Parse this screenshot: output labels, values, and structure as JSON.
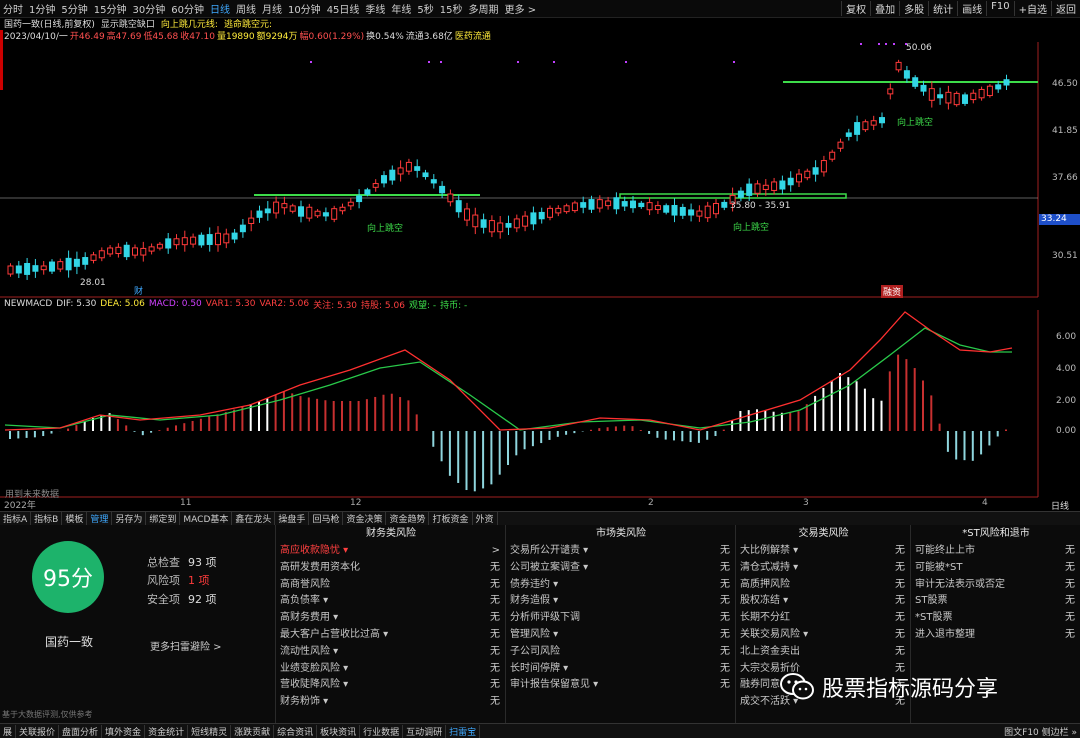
{
  "topbar": {
    "periods": [
      "分时",
      "1分钟",
      "5分钟",
      "15分钟",
      "30分钟",
      "60分钟",
      "日线",
      "周线",
      "月线",
      "10分钟",
      "45日线",
      "季线",
      "年线",
      "5秒",
      "15秒",
      "多周期",
      "更多 >"
    ],
    "active_index": 6,
    "right_buttons": [
      "复权",
      "叠加",
      "多股",
      "统计",
      "画线",
      "F10",
      "+自选",
      "返回"
    ]
  },
  "title_line": {
    "name": "国药一致(日线,前复权)",
    "toggle": "显示跳空缺口",
    "ind1": "向上跳几元线: ",
    "ind2": "逃命跳空元: "
  },
  "quote_line": {
    "date": "2023/04/10/一",
    "open": "开46.49",
    "high": "高47.69",
    "low": "低45.68",
    "close": "收47.10",
    "vol": "量19890",
    "amount": "额9294万",
    "change": "幅0.60(1.29%)",
    "turnover": "换0.54%",
    "float": "流通3.68亿",
    "sector": "医药流通"
  },
  "price_axis": [
    "46.50",
    "41.85",
    "37.66",
    "33.24",
    "30.51"
  ],
  "current_price": "33.24",
  "annotations": {
    "high": "50.06",
    "low": "28.01",
    "gap_range": "35.80 - 35.91",
    "gap_label": "向上跳空",
    "marker1": "财",
    "marker2": "融资"
  },
  "macd_legend": {
    "name": "NEWMACD",
    "dif": "DIF: 5.30",
    "dea": "DEA: 5.06",
    "macd": "MACD: 0.50",
    "var1": "VAR1: 5.30",
    "var2": "VAR2: 5.06",
    "attention": "关注: 5.30",
    "hold": "持股: 5.06",
    "watch": "观望: -",
    "holdcoin": "持币: -"
  },
  "macd_axis": [
    "6.00",
    "4.00",
    "2.00",
    "0.00"
  ],
  "future_label": "用到未来数据",
  "time_axis": [
    "2022年",
    "11",
    "12",
    "2",
    "3",
    "4"
  ],
  "day_button": "日线",
  "tabs": [
    "指标A",
    "指标B",
    "模板",
    "管理",
    "另存为",
    "绑定到",
    "MACD基本",
    "鑫在龙头",
    "操盘手",
    "回马枪",
    "资金决策",
    "资金趋势",
    "打板资金",
    "外资"
  ],
  "active_tab": 3,
  "score": {
    "value": "95分",
    "name": "国药一致",
    "total_label": "总检查",
    "total": "93 项",
    "risk_label": "风险项",
    "risk": "1 项",
    "safe_label": "安全项",
    "safe": "92 项",
    "more": "更多扫雷避险 >"
  },
  "risk_columns": [
    {
      "title": "财务类风险",
      "items": [
        {
          "name": "高应收款隐忧 ▾",
          "status": ">"
        },
        {
          "name": "高研发费用资本化",
          "status": "无"
        },
        {
          "name": "高商誉风险",
          "status": "无"
        },
        {
          "name": "高负债率 ▾",
          "status": "无"
        },
        {
          "name": "高财务费用 ▾",
          "status": "无"
        },
        {
          "name": "最大客户占营收比过高 ▾",
          "status": "无"
        },
        {
          "name": "流动性风险 ▾",
          "status": "无"
        },
        {
          "name": "业绩变脸风险 ▾",
          "status": "无"
        },
        {
          "name": "营收陡降风险 ▾",
          "status": "无"
        },
        {
          "name": "财务粉饰 ▾",
          "status": "无"
        }
      ]
    },
    {
      "title": "市场类风险",
      "items": [
        {
          "name": "交易所公开谴责 ▾",
          "status": "无"
        },
        {
          "name": "公司被立案调查 ▾",
          "status": "无"
        },
        {
          "name": "债券违约 ▾",
          "status": "无"
        },
        {
          "name": "财务造假 ▾",
          "status": "无"
        },
        {
          "name": "分析师评级下调",
          "status": "无"
        },
        {
          "name": "管理风险 ▾",
          "status": "无"
        },
        {
          "name": "子公司风险",
          "status": "无"
        },
        {
          "name": "长时间停牌 ▾",
          "status": "无"
        },
        {
          "name": "审计报告保留意见 ▾",
          "status": "无"
        }
      ]
    },
    {
      "title": "交易类风险",
      "items": [
        {
          "name": "大比例解禁 ▾",
          "status": "无"
        },
        {
          "name": "清仓式减持 ▾",
          "status": "无"
        },
        {
          "name": "高质押风险",
          "status": "无"
        },
        {
          "name": "股权冻结 ▾",
          "status": "无"
        },
        {
          "name": "长期不分红",
          "status": "无"
        },
        {
          "name": "关联交易风险 ▾",
          "status": "无"
        },
        {
          "name": "北上资金卖出",
          "status": "无"
        },
        {
          "name": "大宗交易折价",
          "status": "无"
        },
        {
          "name": "融券同意",
          "status": "无"
        },
        {
          "name": "成交不活跃 ▾",
          "status": "无"
        }
      ]
    },
    {
      "title": "*ST风险和退市",
      "items": [
        {
          "name": "可能终止上市",
          "status": "无"
        },
        {
          "name": "可能被*ST",
          "status": "无"
        },
        {
          "name": "审计无法表示或否定",
          "status": "无"
        },
        {
          "name": "ST股票",
          "status": "无"
        },
        {
          "name": "*ST股票",
          "status": "无"
        },
        {
          "name": "进入退市整理",
          "status": "无"
        }
      ]
    }
  ],
  "disclaimer": "基于大数据评测,仅供参考",
  "watermark": "股票指标源码分享",
  "bottombar": {
    "items": [
      "展",
      "关联报价",
      "盘面分析",
      "填外资金",
      "资金统计",
      "短线精灵",
      "涨跌贡献",
      "综合资讯",
      "板块资讯",
      "行业数据",
      "互动调研",
      "扫雷宝"
    ],
    "active_index": 11,
    "right": "图文F10 侧边栏 »"
  },
  "colors": {
    "up": "#ff3a3a",
    "down": "#33d6e6",
    "dif": "#ff3030",
    "dea": "#29c94a",
    "gap_line": "#3ddc4a",
    "accent": "#3fa9ff",
    "score": "#1db36b"
  }
}
